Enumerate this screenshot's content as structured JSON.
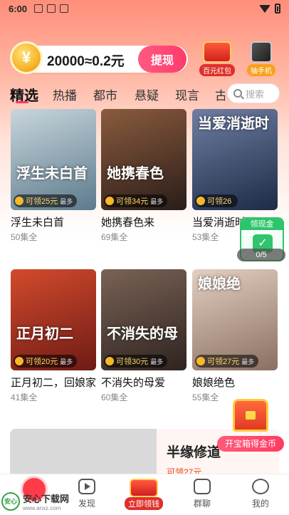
{
  "status_bar": {
    "time": "6:00"
  },
  "banner": {
    "coin_symbol": "¥",
    "exchange_text": "20000≈0.2元",
    "withdraw_label": "提现",
    "promos": [
      {
        "label": "百元红包",
        "icon": "red-envelope-icon"
      },
      {
        "label": "抽手机",
        "icon": "phone-prize-icon"
      }
    ]
  },
  "tabs": [
    "精选",
    "热播",
    "都市",
    "悬疑",
    "现言",
    "古"
  ],
  "active_tab": "精选",
  "search": {
    "placeholder": "搜索"
  },
  "dramas": [
    {
      "title": "浮生未白首",
      "episodes": "50集全",
      "reward": "可领25元",
      "reward_suffix": "最多",
      "poster_text": "浮生未白首",
      "colors": [
        "#5d7a8c",
        "#c8d6dd"
      ]
    },
    {
      "title": "她携春色来",
      "episodes": "69集全",
      "reward": "可领34元",
      "reward_suffix": "最多",
      "poster_text": "她携春色",
      "colors": [
        "#2a1d1a",
        "#8a5b3d"
      ]
    },
    {
      "title": "当爱消逝时",
      "episodes": "53集全",
      "reward": "可领26",
      "reward_suffix": "",
      "poster_text": "当爱消逝时",
      "colors": [
        "#1e2b45",
        "#6f7ea3"
      ]
    },
    {
      "title": "正月初二，回娘家",
      "episodes": "41集全",
      "reward": "可领20元",
      "reward_suffix": "最多",
      "poster_text": "正月初二",
      "colors": [
        "#6e1b16",
        "#d24a2c"
      ]
    },
    {
      "title": "不消失的母爱",
      "episodes": "60集全",
      "reward": "可领30元",
      "reward_suffix": "最多",
      "poster_text": "不消失的母",
      "colors": [
        "#2e2420",
        "#7a6255"
      ]
    },
    {
      "title": "娘娘绝色",
      "episodes": "55集全",
      "reward": "可领27元",
      "reward_suffix": "最多",
      "poster_text": "娘娘绝",
      "colors": [
        "#8a6f60",
        "#e3cfc2"
      ]
    }
  ],
  "cash_widget": {
    "label": "领现金",
    "progress": "0/5"
  },
  "treasure": {
    "label": "开宝箱得金币"
  },
  "featured": {
    "title": "半缘修道",
    "reward": "可领27元"
  },
  "bottom_nav": {
    "discover": "发现",
    "earn": "立即领钱",
    "group": "群聊",
    "mine": "我的"
  },
  "watermark": {
    "text": "安心下载网",
    "sub": "www.anxz.com",
    "badge": "安心"
  }
}
